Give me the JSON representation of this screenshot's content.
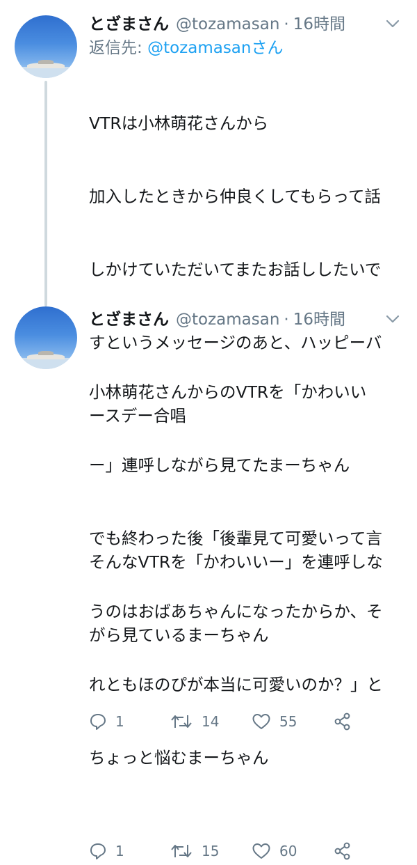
{
  "tweets": [
    {
      "name": "とざまさん",
      "handle": "@tozamasan",
      "separator": "·",
      "time": "16時間",
      "reply_to_prefix": "返信先: ",
      "reply_to_handle": "@tozamasanさん",
      "lines": [
        "VTRは小林萌花さんから",
        "加入したときから仲良くしてもらって話",
        "しかけていただいてまたお話ししたいで",
        "すというメッセージのあと、ハッピーバ",
        "ースデー合唱",
        "",
        "そんなVTRを「かわいいー」を連呼しな",
        "がら見ているまーちゃん"
      ],
      "replies": "1",
      "retweets": "14",
      "likes": "55"
    },
    {
      "name": "とざまさん",
      "handle": "@tozamasan",
      "separator": "·",
      "time": "16時間",
      "lines": [
        "小林萌花さんからのVTRを「かわいい",
        "ー」連呼しながら見てたまーちゃん",
        "でも終わった後「後輩見て可愛いって言",
        "うのはおばあちゃんになったからか、そ",
        "れともほのぴが本当に可愛いのか？」と",
        "ちょっと悩むまーちゃん"
      ],
      "replies": "1",
      "retweets": "15",
      "likes": "60"
    }
  ],
  "colors": {
    "text": "#14171a",
    "secondary": "#657786",
    "link": "#1da1f2",
    "thread_line": "#cfd9de"
  },
  "icons": [
    "reply-icon",
    "retweet-icon",
    "like-icon",
    "share-icon",
    "chevron-down-icon"
  ]
}
